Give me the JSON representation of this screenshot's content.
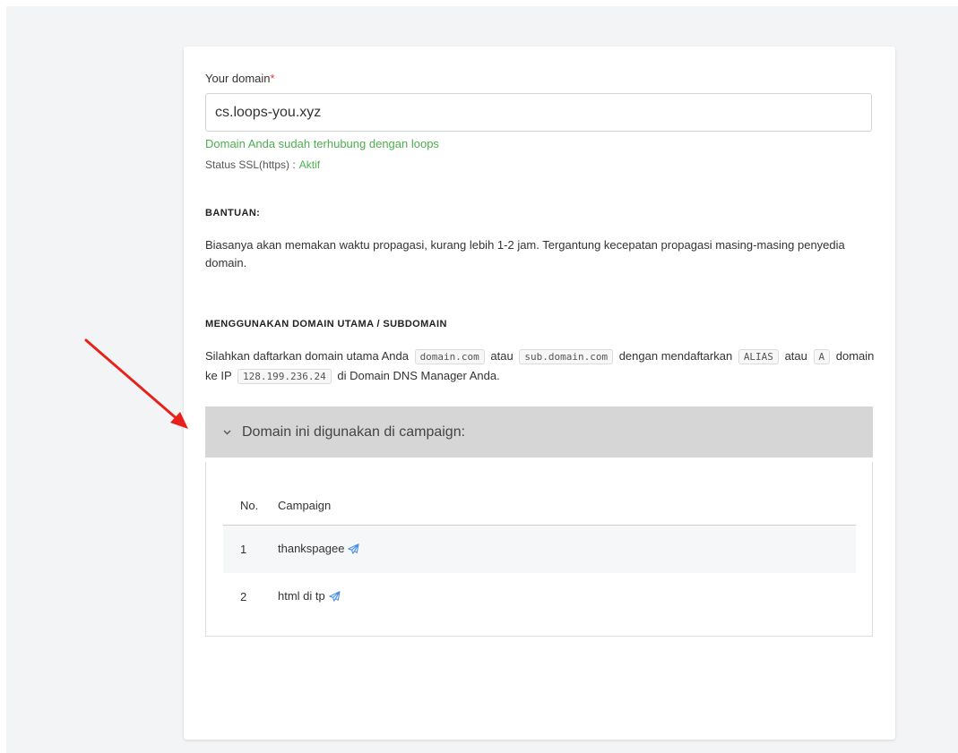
{
  "form": {
    "domain_label": "Your domain",
    "required_mark": "*",
    "domain_value": "cs.loops-you.xyz",
    "connected_message": "Domain Anda sudah terhubung dengan loops",
    "ssl_label": "Status SSL(https) :",
    "ssl_value": "Aktif"
  },
  "help": {
    "title": "BANTUAN:",
    "text": "Biasanya akan memakan waktu propagasi, kurang lebih 1-2 jam. Tergantung kecepatan propagasi masing-masing penyedia domain."
  },
  "domain_section": {
    "title": "MENGGUNAKAN DOMAIN UTAMA / SUBDOMAIN",
    "text_1": "Silahkan daftarkan domain utama Anda",
    "code_1": "domain.com",
    "text_2": "atau",
    "code_2": "sub.domain.com",
    "text_3": "dengan mendaftarkan",
    "code_3": "ALIAS",
    "text_4": "atau",
    "code_4": "A",
    "text_5": "domain ke IP",
    "code_5": "128.199.236.24",
    "text_6": "di Domain DNS Manager Anda."
  },
  "campaigns": {
    "header": "Domain ini digunakan di campaign:",
    "columns": [
      "No.",
      "Campaign"
    ],
    "rows": [
      {
        "no": "1",
        "name": "thankspagee"
      },
      {
        "no": "2",
        "name": "html di tp"
      }
    ]
  },
  "colors": {
    "accent_green": "#4caf50",
    "arrow_red": "#e8211b",
    "link_blue": "#4a8fe7"
  },
  "icons": {
    "chevron": "chevron-down-icon",
    "send": "paper-plane-icon"
  }
}
